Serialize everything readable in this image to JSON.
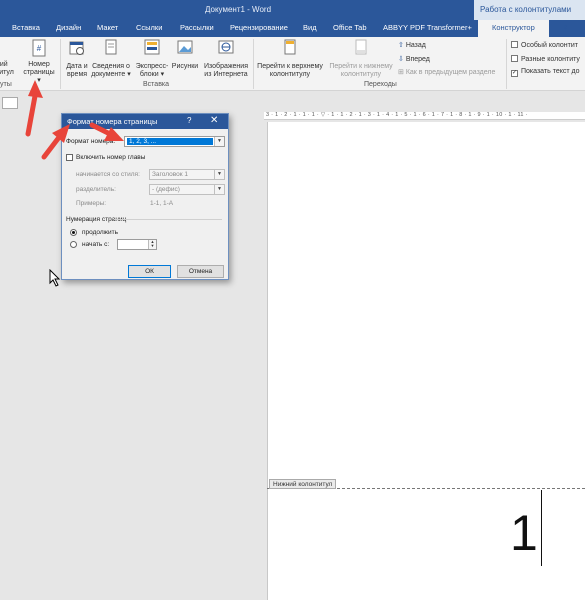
{
  "window": {
    "title": "Документ1 - Word",
    "tools_title": "Работа с колонтитулами"
  },
  "tabs": [
    {
      "label": "Вставка"
    },
    {
      "label": "Дизайн"
    },
    {
      "label": "Макет"
    },
    {
      "label": "Ссылки"
    },
    {
      "label": "Рассылки"
    },
    {
      "label": "Рецензирование"
    },
    {
      "label": "Вид"
    },
    {
      "label": "Office Tab"
    },
    {
      "label": "ABBYY PDF Transformer+"
    },
    {
      "label": "Конструктор"
    }
  ],
  "tell_icon": "lightbulb-icon",
  "ribbon": {
    "left_cut": {
      "line1": "ний",
      "line2": "титул"
    },
    "page_number": {
      "line1": "Номер",
      "line2": "страницы"
    },
    "group_left_cut": "уты",
    "insert_buttons": [
      {
        "line1": "Дата и",
        "line2": "время"
      },
      {
        "line1": "Сведения о",
        "line2": "документе"
      },
      {
        "line1": "Экспресс-",
        "line2": "блоки"
      },
      {
        "line1": "Рисунки",
        "line2": ""
      },
      {
        "line1": "Изображения",
        "line2": "из Интернета"
      }
    ],
    "insert_group": "Вставка",
    "nav_buttons": [
      {
        "line1": "Перейти к верхнему",
        "line2": "колонтитулу"
      },
      {
        "line1": "Перейти к нижнему",
        "line2": "колонтитулу"
      }
    ],
    "nav_small": [
      {
        "label": "Назад"
      },
      {
        "label": "Вперед"
      },
      {
        "label": "Как в предыдущем разделе"
      }
    ],
    "nav_group": "Переходы",
    "options": [
      {
        "label": "Особый колонтит",
        "checked": false
      },
      {
        "label": "Разные колонтиту",
        "checked": false
      },
      {
        "label": "Показать текст до",
        "checked": true
      }
    ]
  },
  "ruler": {
    "numbers": "3 · 1 · 2 · 1 · 1 · 1 · ▽ · 1 · 1 · 2 · 1 · 3 · 1 · 4 · 1 · 5 · 1 · 6 · 1 · 7 · 1 · 8 · 1 · 9 · 1 · 10 · 1 · 11 ·"
  },
  "document": {
    "footer_label": "Нижний колонтитул",
    "page_number": "1"
  },
  "dialog": {
    "title": "Формат номера страницы",
    "help": "?",
    "close": "✕",
    "format_label": "Формат номера:",
    "format_value": "1, 2, 3, ...",
    "include_chapter": "Включить номер главы",
    "starts_with_style_label": "начинается со стиля:",
    "starts_with_style_value": "Заголовок 1",
    "separator_label": "разделитель:",
    "separator_value": "-   (дефис)",
    "examples_label": "Примеры:",
    "examples_value": "1-1, 1-A",
    "numbering_label": "Нумерация страниц",
    "continue_label": "продолжить",
    "start_at_label": "начать с:",
    "start_at_value": "",
    "ok": "ОК",
    "cancel": "Отмена"
  },
  "colors": {
    "word_blue": "#2b579a",
    "annotation_red": "#e8443a",
    "selection_blue": "#0078d7"
  }
}
